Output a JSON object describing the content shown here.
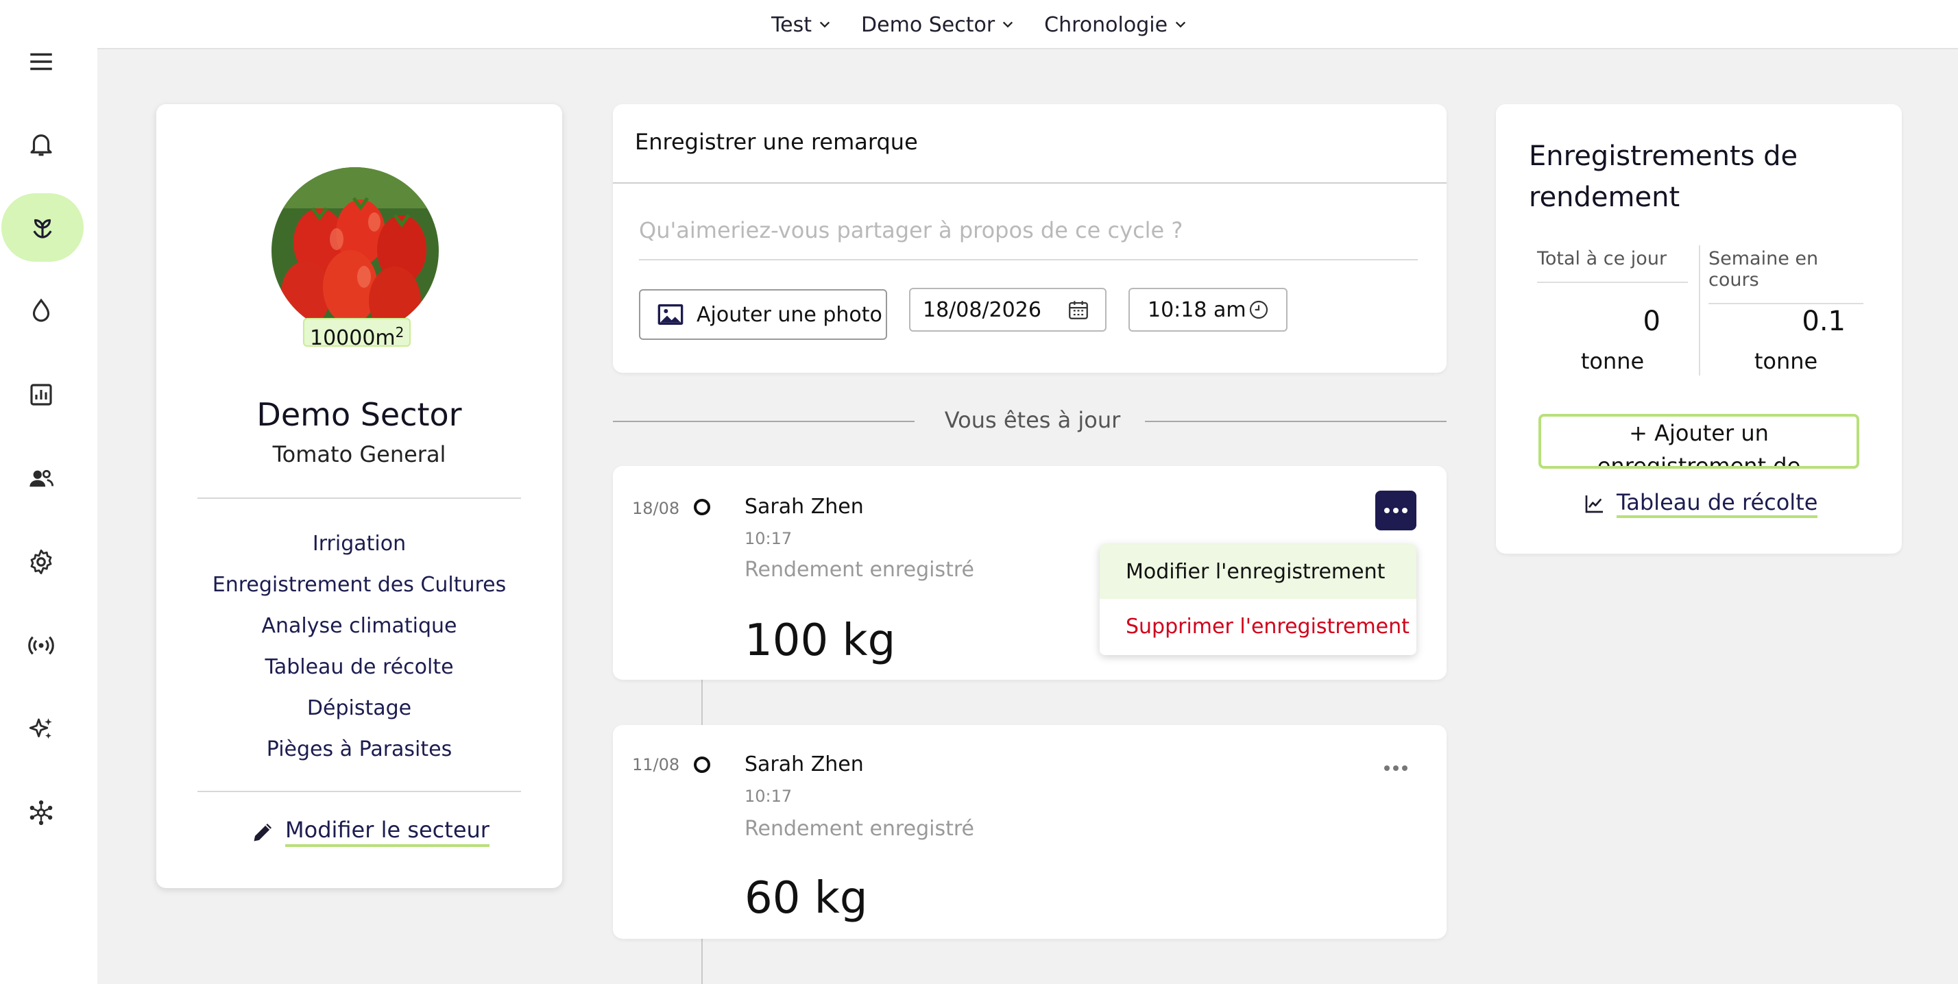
{
  "topnav": {
    "items": [
      "Test",
      "Demo Sector",
      "Chronologie"
    ]
  },
  "sidebar": {
    "icons": [
      "menu-icon",
      "bell-icon",
      "sprout-icon",
      "water-drop-icon",
      "bar-chart-icon",
      "users-icon",
      "gear-icon",
      "broadcast-icon",
      "sparkles-icon",
      "network-icon"
    ],
    "active": "sprout-icon"
  },
  "sector": {
    "area_value": "10000m",
    "area_sup": "2",
    "name": "Demo Sector",
    "crop": "Tomato General",
    "links": [
      "Irrigation",
      "Enregistrement des Cultures",
      "Analyse climatique",
      "Tableau de récolte",
      "Dépistage",
      "Pièges à Parasites"
    ],
    "edit_label": "Modifier le secteur"
  },
  "remark": {
    "title": "Enregistrer une remarque",
    "placeholder": "Qu'aimeriez-vous partager à propos de ce cycle ?",
    "add_photo_label": "Ajouter une photo",
    "date": "18/08/2026",
    "time": "10:18 am"
  },
  "timeline": {
    "status": "Vous êtes à jour",
    "entries": [
      {
        "date": "18/08",
        "author": "Sarah Zhen",
        "time": "10:17",
        "kind": "Rendement enregistré",
        "value": "100 kg"
      },
      {
        "date": "11/08",
        "author": "Sarah Zhen",
        "time": "10:17",
        "kind": "Rendement enregistré",
        "value": "60 kg"
      }
    ],
    "menu": {
      "edit": "Modifier l'enregistrement",
      "delete": "Supprimer l'enregistrement"
    }
  },
  "yield": {
    "title": "Enregistrements de rendement",
    "total_label": "Total à ce jour",
    "week_label": "Semaine en cours",
    "total_value": "0",
    "total_unit": "tonne",
    "week_value": "0.1",
    "week_unit": "tonne",
    "add_label": "+ Ajouter un enregistrement de rendement",
    "harvest_link": "Tableau de récolte"
  },
  "colors": {
    "accent_green": "#b8e07a",
    "active_green": "#d6f5b6",
    "dark_navy": "#1d1b4f",
    "danger_red": "#d0021b"
  }
}
